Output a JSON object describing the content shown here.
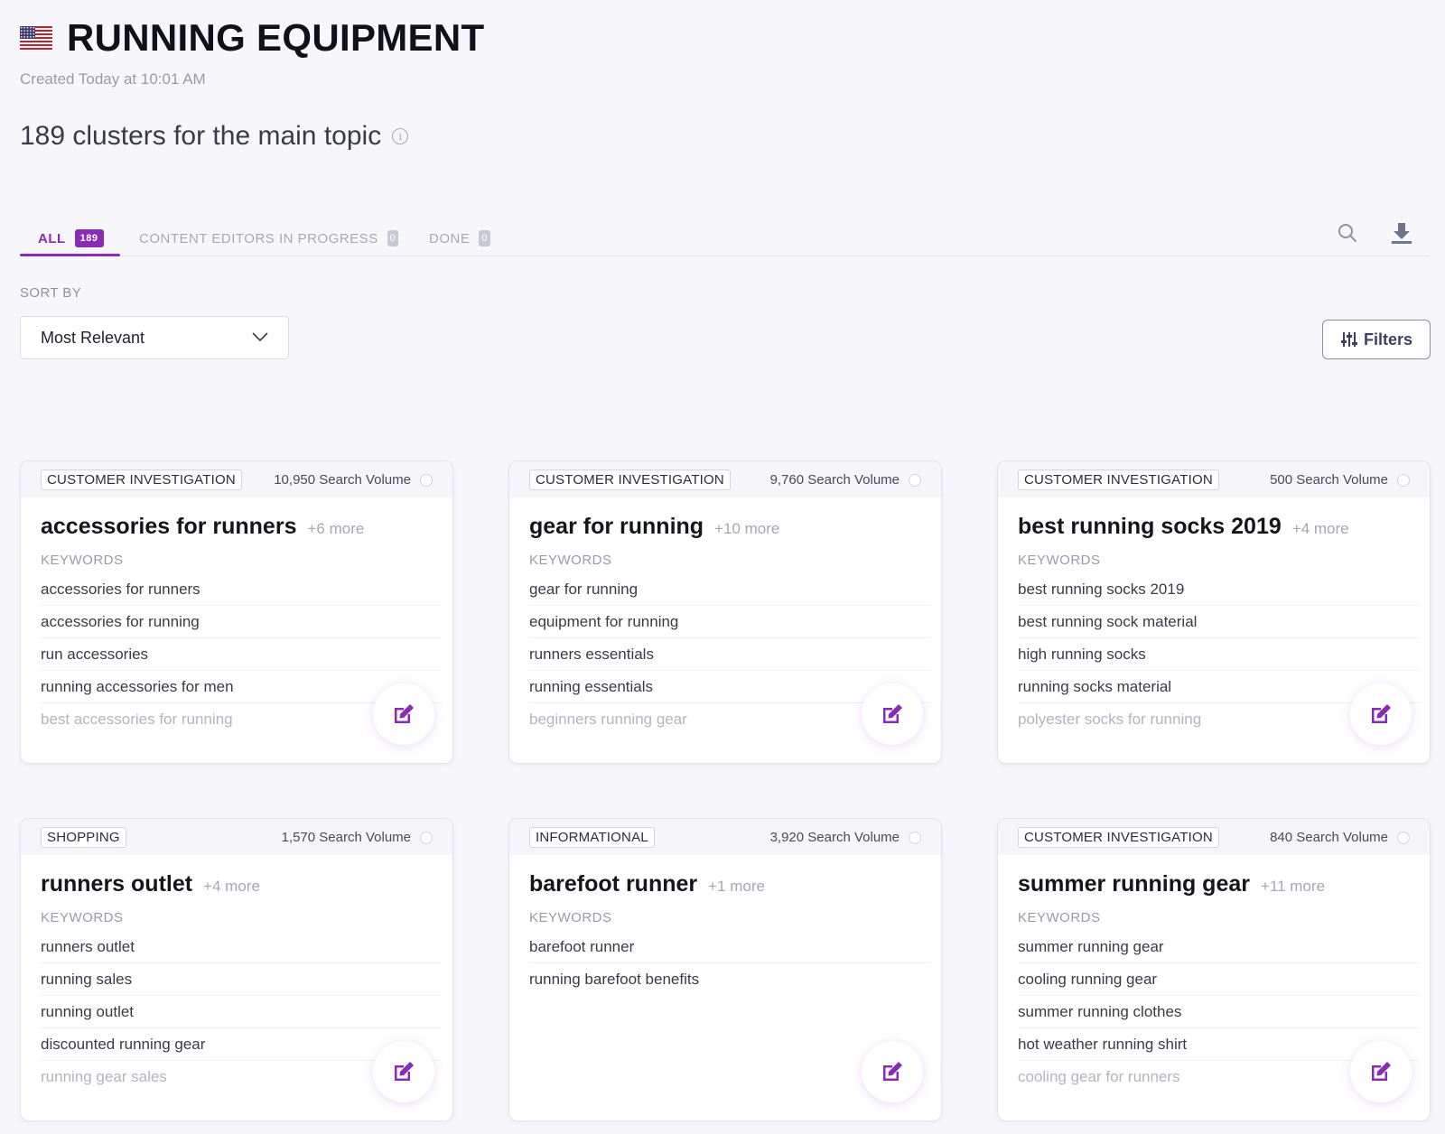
{
  "header": {
    "flag_icon": "us-flag-icon",
    "title": "RUNNING EQUIPMENT",
    "created": "Created Today at 10:01 AM",
    "clusters_title": "189 clusters for the main topic",
    "info_glyph": "i"
  },
  "tabs": [
    {
      "label": "ALL",
      "count": "189"
    },
    {
      "label": "CONTENT EDITORS IN PROGRESS",
      "count": "0"
    },
    {
      "label": "DONE",
      "count": "0"
    }
  ],
  "toolbar": {
    "search_icon": "search-icon",
    "download_icon": "download-icon"
  },
  "sort": {
    "label": "SORT BY",
    "selected": "Most Relevant"
  },
  "filters": {
    "label": "Filters"
  },
  "colors": {
    "accent": "#8a2bb6",
    "background": "#f7f7fb"
  },
  "cards": [
    {
      "tag": "CUSTOMER INVESTIGATION",
      "volume": "10,950 Search Volume",
      "title": "accessories for runners",
      "more": "+6 more",
      "keywords_label": "KEYWORDS",
      "keywords": [
        "accessories for runners",
        "accessories for running",
        "run accessories",
        "running accessories for men",
        "best accessories for running"
      ]
    },
    {
      "tag": "CUSTOMER INVESTIGATION",
      "volume": "9,760 Search Volume",
      "title": "gear for running",
      "more": "+10 more",
      "keywords_label": "KEYWORDS",
      "keywords": [
        "gear for running",
        "equipment for running",
        "runners essentials",
        "running essentials",
        "beginners running gear"
      ]
    },
    {
      "tag": "CUSTOMER INVESTIGATION",
      "volume": "500 Search Volume",
      "title": "best running socks 2019",
      "more": "+4 more",
      "keywords_label": "KEYWORDS",
      "keywords": [
        "best running socks 2019",
        "best running sock material",
        "high running socks",
        "running socks material",
        "polyester socks for running"
      ]
    },
    {
      "tag": "SHOPPING",
      "volume": "1,570 Search Volume",
      "title": "runners outlet",
      "more": "+4 more",
      "keywords_label": "KEYWORDS",
      "keywords": [
        "runners outlet",
        "running sales",
        "running outlet",
        "discounted running gear",
        "running gear sales"
      ]
    },
    {
      "tag": "INFORMATIONAL",
      "volume": "3,920 Search Volume",
      "title": "barefoot runner",
      "more": "+1 more",
      "keywords_label": "KEYWORDS",
      "keywords": [
        "barefoot runner",
        "running barefoot benefits"
      ]
    },
    {
      "tag": "CUSTOMER INVESTIGATION",
      "volume": "840 Search Volume",
      "title": "summer running gear",
      "more": "+11 more",
      "keywords_label": "KEYWORDS",
      "keywords": [
        "summer running gear",
        "cooling running gear",
        "summer running clothes",
        "hot weather running shirt",
        "cooling gear for runners"
      ]
    }
  ]
}
